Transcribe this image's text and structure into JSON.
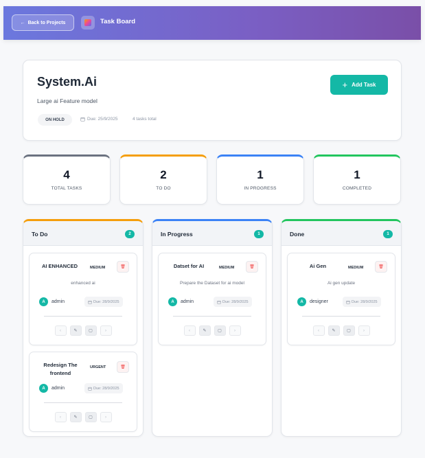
{
  "header": {
    "back_label": "Back to Projects",
    "back_arrow": "←",
    "title": "Task Board"
  },
  "project": {
    "name": "System.Ai",
    "description": "Large ai Feature model",
    "status": "ON HOLD",
    "due": "Due: 25/9/2025",
    "total": "4 tasks total",
    "add_task_label": "Add Task"
  },
  "stats": [
    {
      "value": "4",
      "label": "TOTAL TASKS",
      "color": "#6b7280"
    },
    {
      "value": "2",
      "label": "TO DO",
      "color": "#f59e0b"
    },
    {
      "value": "1",
      "label": "IN PROGRESS",
      "color": "#3b82f6"
    },
    {
      "value": "1",
      "label": "COMPLETED",
      "color": "#22c55e"
    }
  ],
  "columns": [
    {
      "title": "To Do",
      "count": "2",
      "color": "#f59e0b",
      "tasks": [
        {
          "title": "AI ENHANCED",
          "priority": "MEDIUM",
          "description": "enhanced ai",
          "assignee": "admin",
          "initial": "A",
          "due": "Due: 28/9/2025"
        },
        {
          "title": "Redesign The frontend",
          "priority": "URGENT",
          "description": "",
          "assignee": "admin",
          "initial": "A",
          "due": "Due: 28/9/2025"
        }
      ]
    },
    {
      "title": "In Progress",
      "count": "1",
      "color": "#3b82f6",
      "tasks": [
        {
          "title": "Datset for AI",
          "priority": "MEDIUM",
          "description": "Prepare the Dataset for ai model",
          "assignee": "admin",
          "initial": "A",
          "due": "Due: 28/9/2025"
        }
      ]
    },
    {
      "title": "Done",
      "count": "1",
      "color": "#22c55e",
      "tasks": [
        {
          "title": "Ai Gen",
          "priority": "MEDIUM",
          "description": "Ai gen update",
          "assignee": "designer",
          "initial": "A",
          "due": "Due: 28/9/2025"
        }
      ]
    }
  ],
  "task_action_icons": [
    "chevron-left-icon",
    "edit-icon",
    "copy-icon",
    "chevron-right-icon"
  ],
  "colors": {
    "accent": "#14b8a6",
    "header_start": "#6b78de",
    "header_end": "#7a4fa8",
    "delete": "#ef4444"
  }
}
